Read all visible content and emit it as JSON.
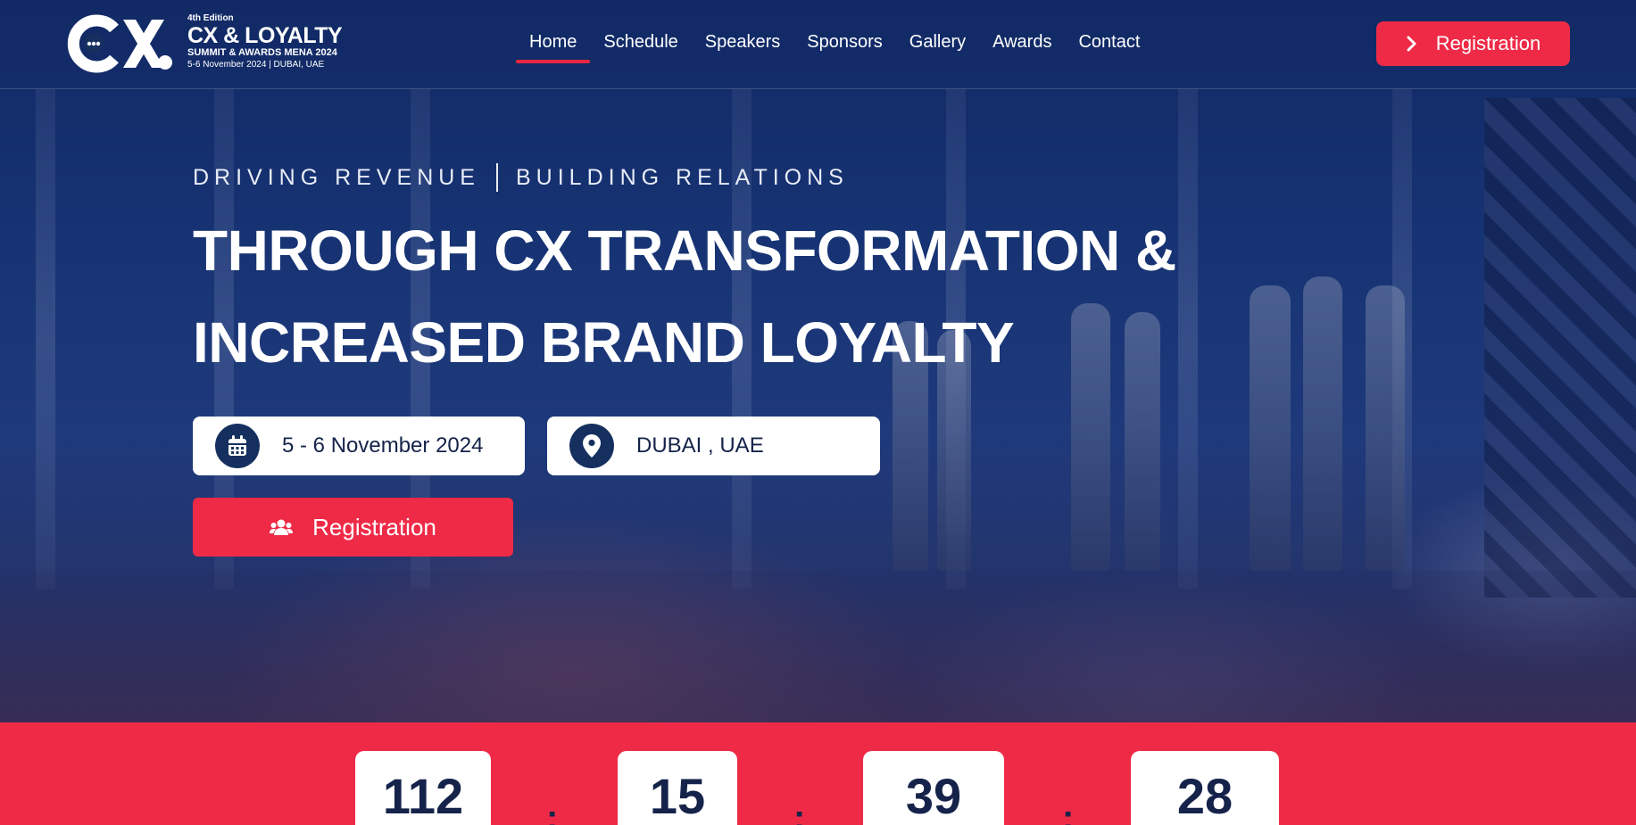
{
  "header": {
    "logo": {
      "mark": "CX",
      "edition": "4th Edition",
      "title": "CX & LOYALTY",
      "subtitle": "SUMMIT & AWARDS MENA 2024",
      "date_line": "5-6 November 2024 | DUBAI, UAE"
    },
    "nav": [
      {
        "label": "Home",
        "active": true
      },
      {
        "label": "Schedule"
      },
      {
        "label": "Speakers"
      },
      {
        "label": "Sponsors"
      },
      {
        "label": "Gallery"
      },
      {
        "label": "Awards"
      },
      {
        "label": "Contact"
      }
    ],
    "cta": {
      "label": "Registration",
      "icon": "chevron-right-icon"
    }
  },
  "hero": {
    "tagline_left": "DRIVING REVENUE",
    "tagline_right": "BUILDING RELATIONS",
    "headline_line1": "THROUGH CX TRANSFORMATION &",
    "headline_line2": "INCREASED BRAND LOYALTY",
    "date": {
      "text": "5 - 6 November 2024",
      "icon": "calendar-icon"
    },
    "location": {
      "text": "DUBAI , UAE",
      "icon": "map-pin-icon"
    },
    "cta": {
      "label": "Registration",
      "icon": "users-icon"
    }
  },
  "countdown": {
    "values": [
      "112",
      "15",
      "39",
      "28"
    ],
    "separator": ":"
  },
  "colors": {
    "navy": "#15305f",
    "accent_red": "#ee2a47",
    "text_dark": "#15234a"
  }
}
